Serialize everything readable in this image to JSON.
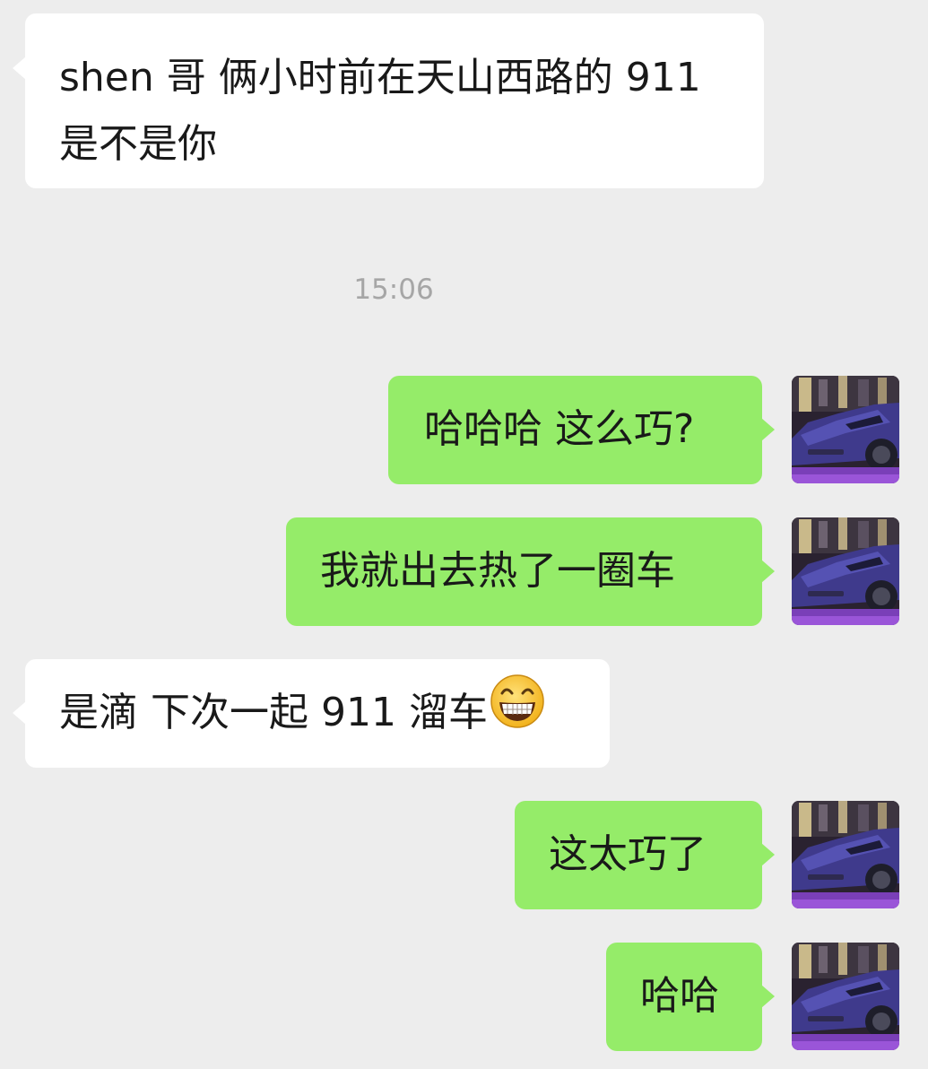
{
  "chat": {
    "messages": [
      {
        "side": "in",
        "lines": [
          "shen 哥 俩小时前在天山西路的 911",
          "是不是你"
        ]
      },
      {
        "side": "out",
        "text": "哈哈哈 这么巧?"
      },
      {
        "side": "out",
        "text": "我就出去热了一圈车"
      },
      {
        "side": "in",
        "text": "是滴 下次一起 911 溜车",
        "emoji": "grinning-face-icon"
      },
      {
        "side": "out",
        "text": "这太巧了"
      },
      {
        "side": "out",
        "text": "哈哈"
      }
    ],
    "timestamp": "15:06"
  },
  "colors": {
    "background": "#ededed",
    "incoming_bubble": "#ffffff",
    "outgoing_bubble": "#95ec69",
    "timestamp_text": "#a6a6a6"
  }
}
